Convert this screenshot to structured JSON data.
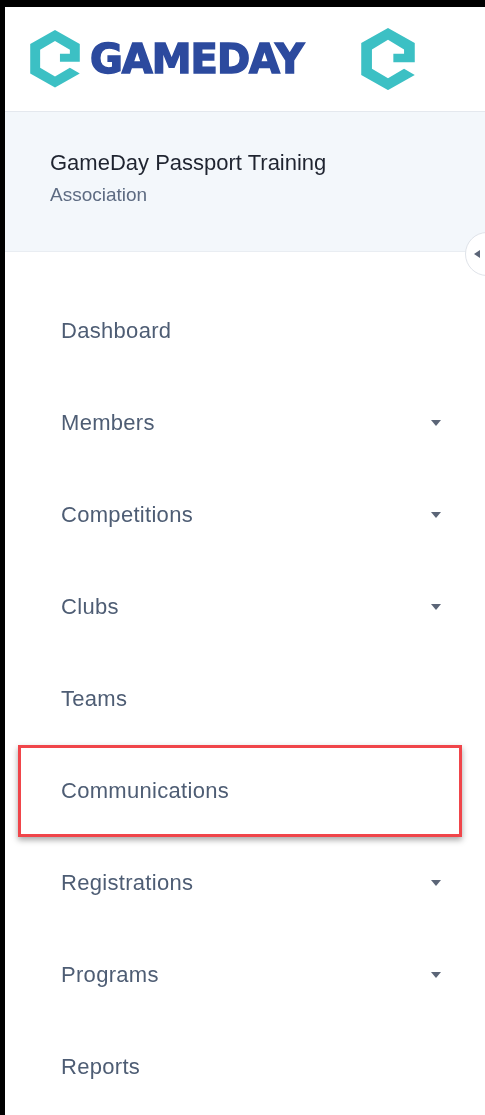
{
  "logo": {
    "wordmark": "GAMEDAY"
  },
  "organisation": {
    "name": "GameDay Passport Training",
    "type": "Association"
  },
  "menu": [
    {
      "label": "Dashboard",
      "kind": "link",
      "highlighted": false
    },
    {
      "label": "Members",
      "kind": "submenu",
      "highlighted": false
    },
    {
      "label": "Competitions",
      "kind": "submenu",
      "highlighted": false
    },
    {
      "label": "Clubs",
      "kind": "submenu",
      "highlighted": false
    },
    {
      "label": "Teams",
      "kind": "link",
      "highlighted": false
    },
    {
      "label": "Communications",
      "kind": "link",
      "highlighted": true
    },
    {
      "label": "Registrations",
      "kind": "submenu",
      "highlighted": false
    },
    {
      "label": "Programs",
      "kind": "submenu",
      "highlighted": false
    },
    {
      "label": "Reports",
      "kind": "link",
      "highlighted": false
    }
  ]
}
